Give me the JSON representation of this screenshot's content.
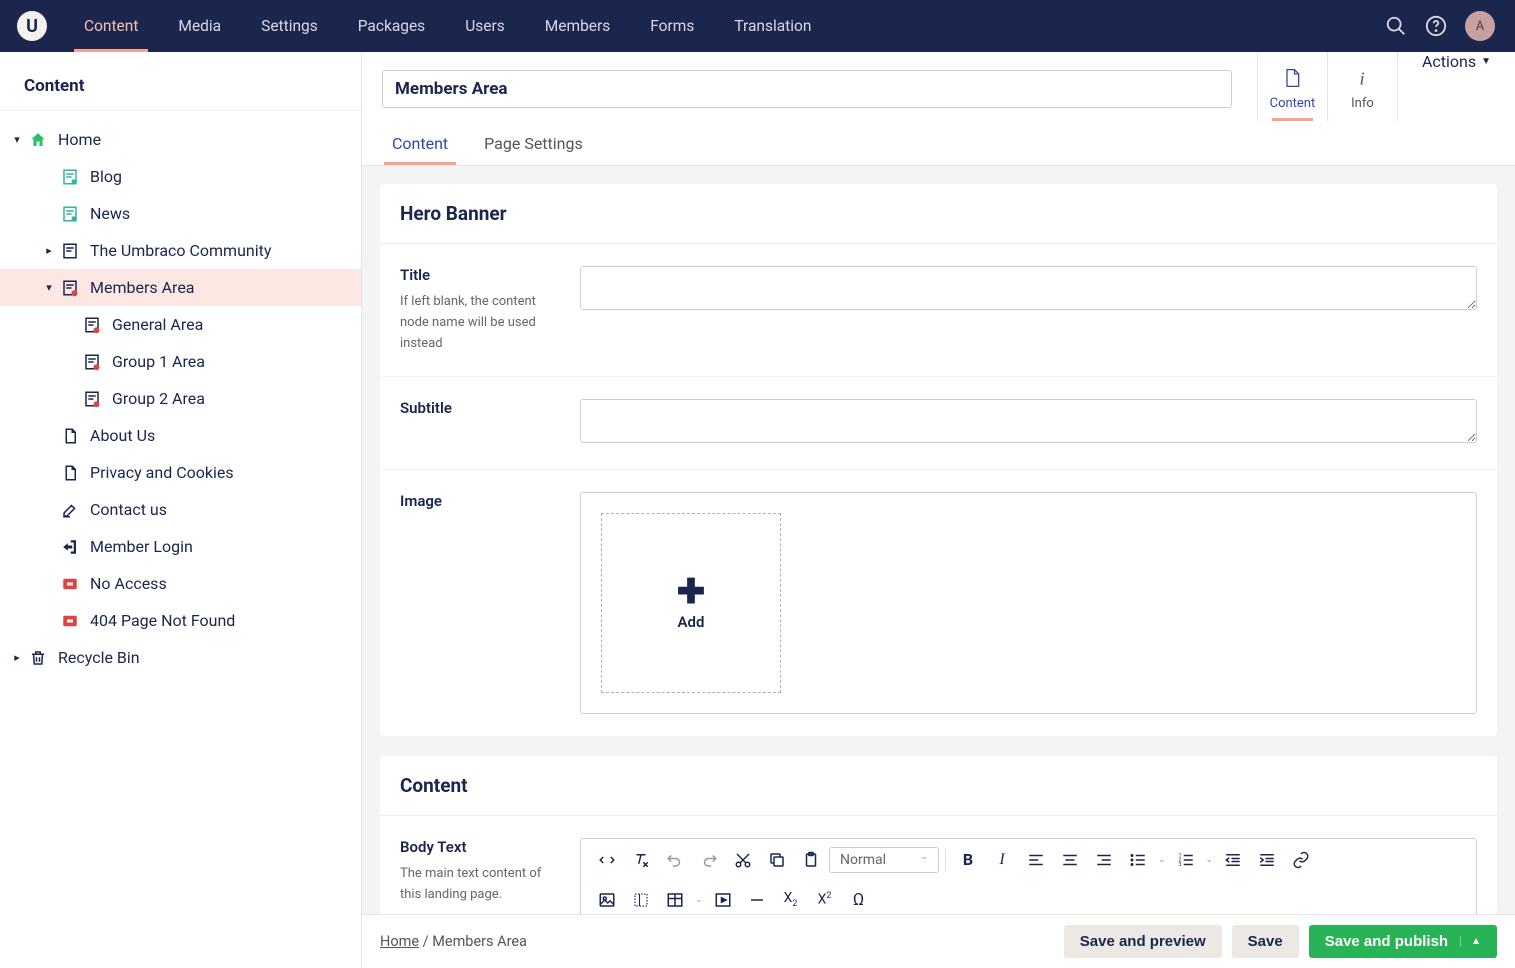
{
  "topnav": {
    "items": [
      "Content",
      "Media",
      "Settings",
      "Packages",
      "Users",
      "Members",
      "Forms",
      "Translation"
    ],
    "active_index": 0,
    "avatar_initial": "A"
  },
  "sidebar": {
    "title": "Content",
    "tree": [
      {
        "label": "Home",
        "depth": 0,
        "icon": "home",
        "caret": "down",
        "color": "#2bbf6d"
      },
      {
        "label": "Blog",
        "depth": 1,
        "icon": "page-teal",
        "caret": ""
      },
      {
        "label": "News",
        "depth": 1,
        "icon": "page-teal",
        "caret": ""
      },
      {
        "label": "The Umbraco Community",
        "depth": 1,
        "icon": "page-dark",
        "caret": "right"
      },
      {
        "label": "Members Area",
        "depth": 1,
        "icon": "page-warn",
        "caret": "down",
        "selected": true
      },
      {
        "label": "General Area",
        "depth": 2,
        "icon": "page-warn",
        "caret": ""
      },
      {
        "label": "Group 1 Area",
        "depth": 2,
        "icon": "page-warn",
        "caret": ""
      },
      {
        "label": "Group 2 Area",
        "depth": 2,
        "icon": "page-warn",
        "caret": ""
      },
      {
        "label": "About Us",
        "depth": 1,
        "icon": "doc",
        "caret": ""
      },
      {
        "label": "Privacy and Cookies",
        "depth": 1,
        "icon": "doc",
        "caret": ""
      },
      {
        "label": "Contact us",
        "depth": 1,
        "icon": "edit",
        "caret": ""
      },
      {
        "label": "Member Login",
        "depth": 1,
        "icon": "login",
        "caret": ""
      },
      {
        "label": "No Access",
        "depth": 1,
        "icon": "block",
        "caret": ""
      },
      {
        "label": "404 Page Not Found",
        "depth": 1,
        "icon": "block",
        "caret": ""
      },
      {
        "label": "Recycle Bin",
        "depth": 0,
        "icon": "trash",
        "caret": "right"
      }
    ]
  },
  "editor": {
    "title_value": "Members Area",
    "apps": {
      "content": "Content",
      "info": "Info"
    },
    "subnav": [
      "Content",
      "Page Settings"
    ],
    "actions_label": "Actions",
    "panels": {
      "hero": {
        "title": "Hero Banner",
        "props": {
          "title_label": "Title",
          "title_desc": "If left blank, the content node name will be used instead",
          "subtitle_label": "Subtitle",
          "image_label": "Image",
          "image_add": "Add"
        }
      },
      "content": {
        "title": "Content",
        "props": {
          "body_label": "Body Text",
          "body_desc": "The main text content of this landing page.",
          "format_label": "Normal"
        }
      }
    },
    "breadcrumb": {
      "home": "Home",
      "sep": "/",
      "current": "Members Area"
    },
    "buttons": {
      "save_preview": "Save and preview",
      "save": "Save",
      "publish": "Save and publish"
    }
  }
}
